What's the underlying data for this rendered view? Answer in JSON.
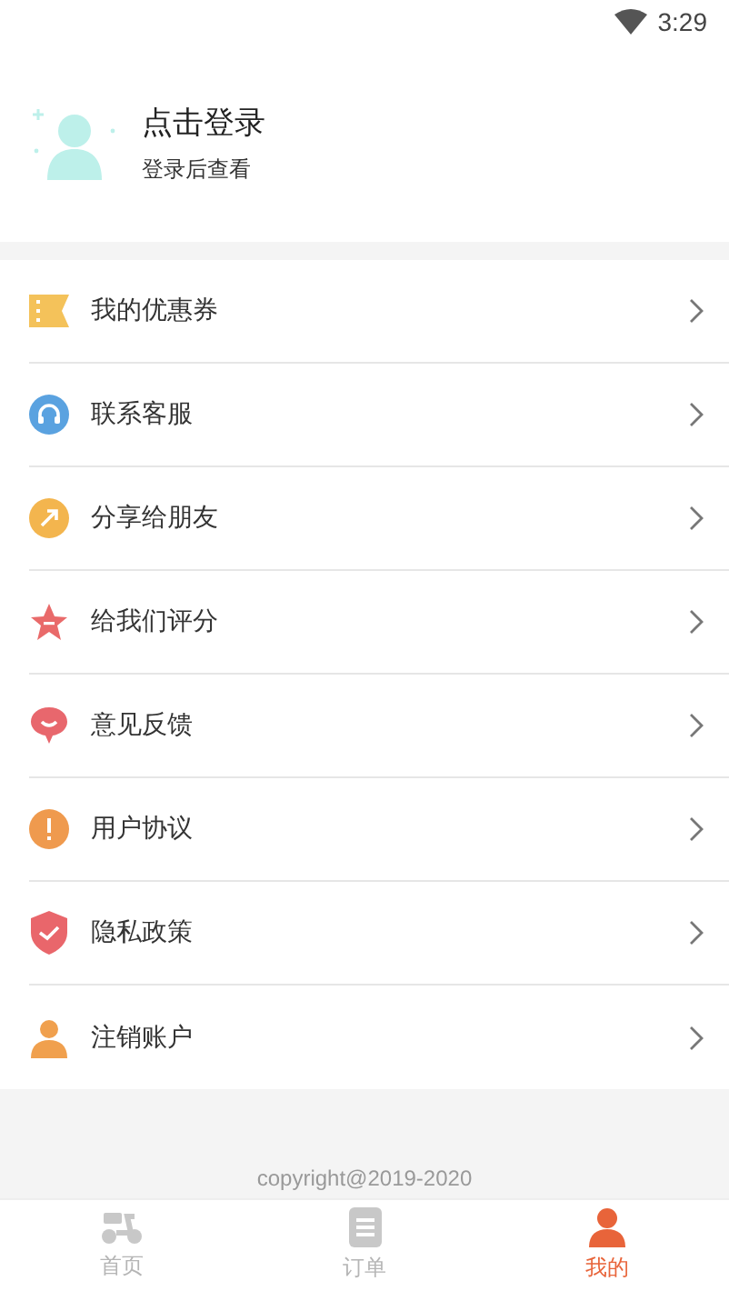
{
  "status_bar": {
    "time": "3:29"
  },
  "profile": {
    "title": "点击登录",
    "subtitle": "登录后查看"
  },
  "menu": [
    {
      "label": "我的优惠券"
    },
    {
      "label": "联系客服"
    },
    {
      "label": "分享给朋友"
    },
    {
      "label": "给我们评分"
    },
    {
      "label": "意见反馈"
    },
    {
      "label": "用户协议"
    },
    {
      "label": "隐私政策"
    },
    {
      "label": "注销账户"
    }
  ],
  "footer": {
    "copyright": "copyright@2019-2020"
  },
  "tabs": [
    {
      "label": "首页",
      "selected": false
    },
    {
      "label": "订单",
      "selected": false
    },
    {
      "label": "我的",
      "selected": true
    }
  ]
}
